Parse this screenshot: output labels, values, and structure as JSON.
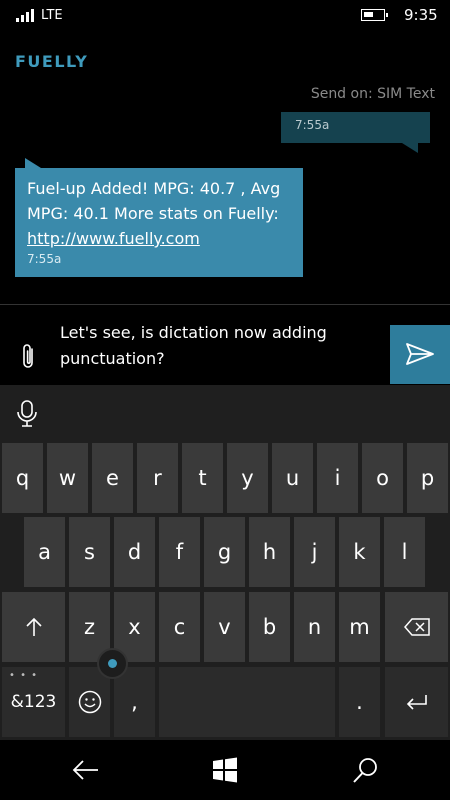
{
  "status_bar": {
    "network": "LTE",
    "time": "9:35"
  },
  "header": {
    "app_title": "FUELLY",
    "send_on": "Send on: SIM Text"
  },
  "conversation": {
    "outgoing": {
      "time": "7:55a"
    },
    "incoming": {
      "text": "Fuel-up Added! MPG: 40.7 , Avg MPG: 40.1 More stats on Fuelly:",
      "link": "http://www.fuelly.com",
      "time": "7:55a"
    }
  },
  "compose": {
    "text": "Let's see, is dictation now adding punctuation?"
  },
  "keyboard": {
    "row1": [
      "q",
      "w",
      "e",
      "r",
      "t",
      "y",
      "u",
      "i",
      "o",
      "p"
    ],
    "row2": [
      "a",
      "s",
      "d",
      "f",
      "g",
      "h",
      "j",
      "k",
      "l"
    ],
    "row3": [
      "z",
      "x",
      "c",
      "v",
      "b",
      "n",
      "m"
    ],
    "symbols_label": "&123",
    "comma": ",",
    "period": "."
  },
  "icons": {
    "signal": "signal-icon",
    "battery": "battery-icon",
    "attach": "paperclip-icon",
    "send": "send-icon",
    "mic": "microphone-icon",
    "shift": "shift-arrow-icon",
    "backspace": "backspace-icon",
    "emoji": "emoji-icon",
    "enter": "enter-icon",
    "back": "back-arrow-icon",
    "windows": "windows-logo-icon",
    "search": "search-icon"
  },
  "colors": {
    "accent": "#3f9bbd",
    "incoming_bubble": "#3a8aab",
    "outgoing_bubble": "#15424f",
    "send_button": "#2e7d9c"
  }
}
